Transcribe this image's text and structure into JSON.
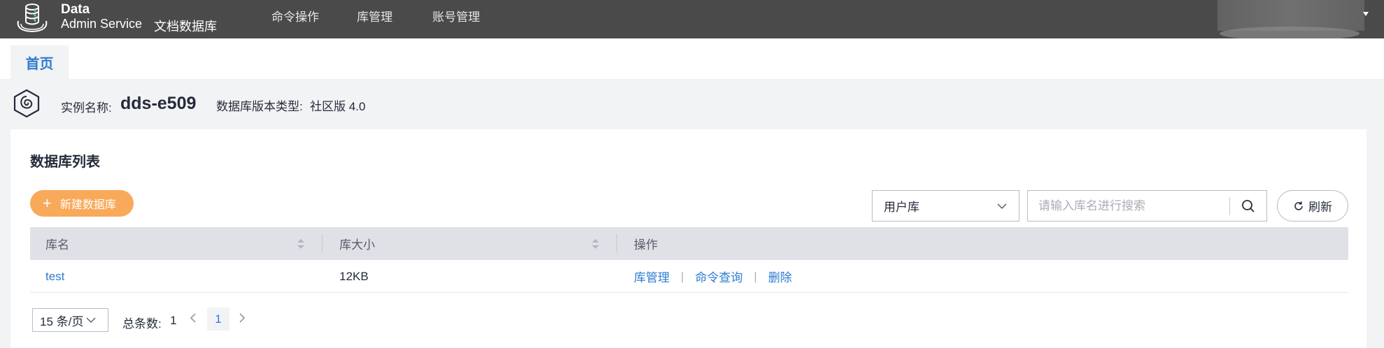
{
  "header": {
    "brand_line1": "Data",
    "brand_line2": "Admin Service",
    "brand_sub": "文档数据库",
    "nav": [
      "命令操作",
      "库管理",
      "账号管理"
    ],
    "logo_icon": "database-stack-icon",
    "user_caret_icon": "caret-down-icon"
  },
  "tabs": {
    "home": "首页"
  },
  "instance": {
    "name_label": "实例名称:",
    "name": "dds-e509",
    "version_label": "数据库版本类型:",
    "version": "社区版 4.0",
    "icon": "mongodb-hexagon-icon"
  },
  "card": {
    "title": "数据库列表",
    "new_button": "新建数据库",
    "db_type_select": "用户库",
    "search_placeholder": "请输入库名进行搜索",
    "refresh_button": "刷新"
  },
  "table": {
    "headers": [
      "库名",
      "库大小",
      "操作"
    ],
    "rows": [
      {
        "name": "test",
        "size": "12KB",
        "actions": [
          "库管理",
          "命令查询",
          "删除"
        ]
      }
    ]
  },
  "pagination": {
    "page_size": "15 条/页",
    "total_label": "总条数:",
    "total": "1",
    "current_page": "1"
  },
  "colors": {
    "topbar": "#4a4a4a",
    "accent": "#2e7ccf",
    "primary_button": "#f9a95a",
    "table_header": "#dfe1e6"
  }
}
